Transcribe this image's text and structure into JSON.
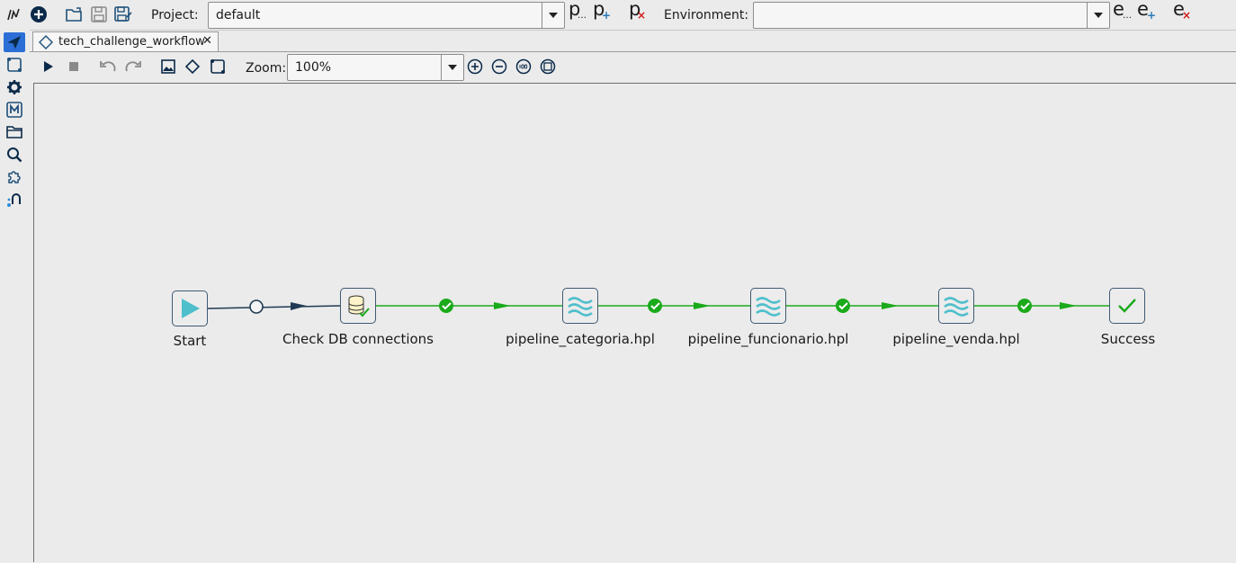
{
  "topbar": {
    "project_label": "Project:",
    "project_value": "default",
    "environment_label": "Environment:",
    "environment_value": "",
    "project_edit_glyph": "p",
    "project_edit_suffix": "…",
    "project_add_glyph": "p",
    "project_add_suffix": "+",
    "project_delete_glyph": "p",
    "project_delete_suffix": "×",
    "env_edit_glyph": "e",
    "env_edit_suffix": "…",
    "env_add_glyph": "e",
    "env_add_suffix": "+",
    "env_delete_glyph": "e",
    "env_delete_suffix": "×"
  },
  "tab": {
    "title": "tech_challenge_workflow",
    "close_glyph": "✕"
  },
  "toolbar": {
    "zoom_label": "Zoom:",
    "zoom_value": "100%"
  },
  "workflow": {
    "nodes": [
      {
        "label": "Start",
        "icon": "start-play-icon"
      },
      {
        "label": "Check DB connections",
        "icon": "database-check-icon"
      },
      {
        "label": "pipeline_categoria.hpl",
        "icon": "pipeline-waves-icon"
      },
      {
        "label": "pipeline_funcionario.hpl",
        "icon": "pipeline-waves-icon"
      },
      {
        "label": "pipeline_venda.hpl",
        "icon": "pipeline-waves-icon"
      },
      {
        "label": "Success",
        "icon": "success-check-icon"
      }
    ],
    "hop_types": [
      "unconditional",
      "success",
      "success",
      "success",
      "success"
    ]
  },
  "colors": {
    "hop_unconditional": "#1f3a52",
    "hop_success": "#1aaa1a",
    "accent_blue": "#1e4f7a",
    "pipeline_teal": "#4fbfcc"
  }
}
